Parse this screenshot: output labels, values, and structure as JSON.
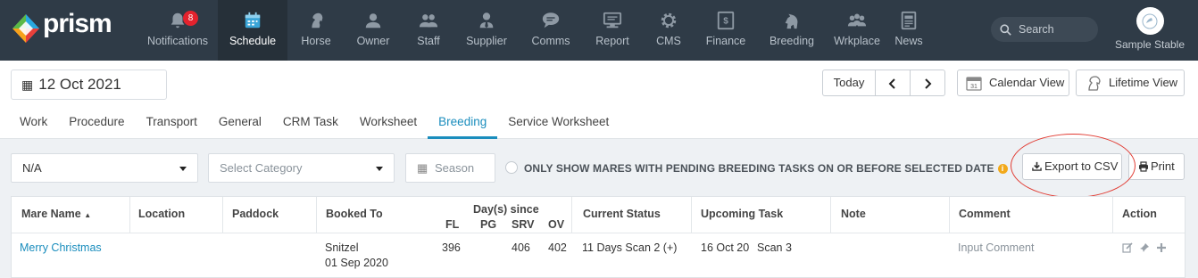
{
  "app": {
    "logo_text": "prism",
    "brand_color": "#2f3b47",
    "accent": "#1a8dbd"
  },
  "nav": [
    {
      "label": "Notifications",
      "icon": "bell-icon",
      "badge": "8"
    },
    {
      "label": "Schedule",
      "icon": "calendar-icon",
      "active": true
    },
    {
      "label": "Horse",
      "icon": "horse-head-icon"
    },
    {
      "label": "Owner",
      "icon": "person-icon"
    },
    {
      "label": "Staff",
      "icon": "people-icon"
    },
    {
      "label": "Supplier",
      "icon": "supplier-icon"
    },
    {
      "label": "Comms",
      "icon": "chat-icon"
    },
    {
      "label": "Report",
      "icon": "report-icon"
    },
    {
      "label": "CMS",
      "icon": "gear-icon"
    },
    {
      "label": "Finance",
      "icon": "dollar-icon"
    },
    {
      "label": "Breeding",
      "icon": "horse-icon"
    },
    {
      "label": "Wrkplace",
      "icon": "workplace-icon"
    },
    {
      "label": "News",
      "icon": "news-icon"
    }
  ],
  "search": {
    "placeholder": "Search"
  },
  "user": {
    "name": "Sample Stable"
  },
  "date": {
    "value": "12 Oct 2021"
  },
  "controls": {
    "today": "Today",
    "prev": "‹",
    "next": "›",
    "calendar_view": "Calendar View",
    "lifetime_view": "Lifetime View"
  },
  "tabs": [
    "Work",
    "Procedure",
    "Transport",
    "General",
    "CRM Task",
    "Worksheet",
    "Breeding",
    "Service Worksheet"
  ],
  "filters": {
    "location": "N/A",
    "category_placeholder": "Select Category",
    "season_placeholder": "Season",
    "pending_label": "ONLY SHOW MARES WITH PENDING BREEDING TASKS ON OR BEFORE SELECTED DATE",
    "export": "Export to CSV",
    "print": "Print"
  },
  "table": {
    "headers": {
      "mare_name": "Mare Name",
      "location": "Location",
      "paddock": "Paddock",
      "booked_to": "Booked To",
      "days_since": "Day(s) since",
      "fl": "FL",
      "pg": "PG",
      "srv": "SRV",
      "ov": "OV",
      "current_status": "Current Status",
      "upcoming_task": "Upcoming Task",
      "note": "Note",
      "comment": "Comment",
      "action": "Action"
    },
    "rows": [
      {
        "mare_name": "Merry Christmas",
        "booked_to_1": "Snitzel",
        "booked_to_2": "01 Sep 2020",
        "fl": "396",
        "pg": "",
        "srv": "406",
        "ov": "402",
        "current_status": "11 Days Scan 2 (+)",
        "upcoming_date": "16 Oct 20",
        "upcoming_task": "Scan 3",
        "comment": "Input Comment"
      }
    ]
  }
}
